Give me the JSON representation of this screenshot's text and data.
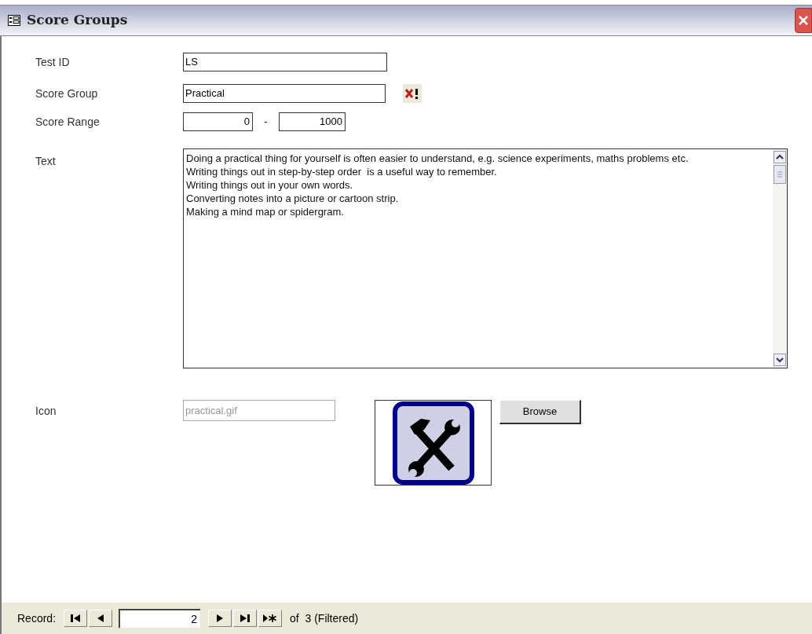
{
  "window": {
    "title": "Score Groups"
  },
  "fields": {
    "test_id": {
      "label": "Test ID",
      "value": "LS"
    },
    "score_group": {
      "label": "Score Group",
      "value": "Practical"
    },
    "score_range": {
      "label": "Score Range",
      "min": "0",
      "separator": "-",
      "max": "1000"
    },
    "text": {
      "label": "Text",
      "value": "Doing a practical thing for yourself is often easier to understand, e.g. science experiments, maths problems etc.\nWriting things out in step-by-step order  is a useful way to remember.\nWriting things out in your own words.\nConverting notes into a picture or cartoon strip.\nMaking a mind map or spidergram."
    },
    "icon": {
      "label": "Icon",
      "value": "practical.gif",
      "disabled": true
    },
    "browse_button": "Browse"
  },
  "record_bar": {
    "label": "Record:",
    "current": "2",
    "total": "of  3 (Filtered)"
  }
}
